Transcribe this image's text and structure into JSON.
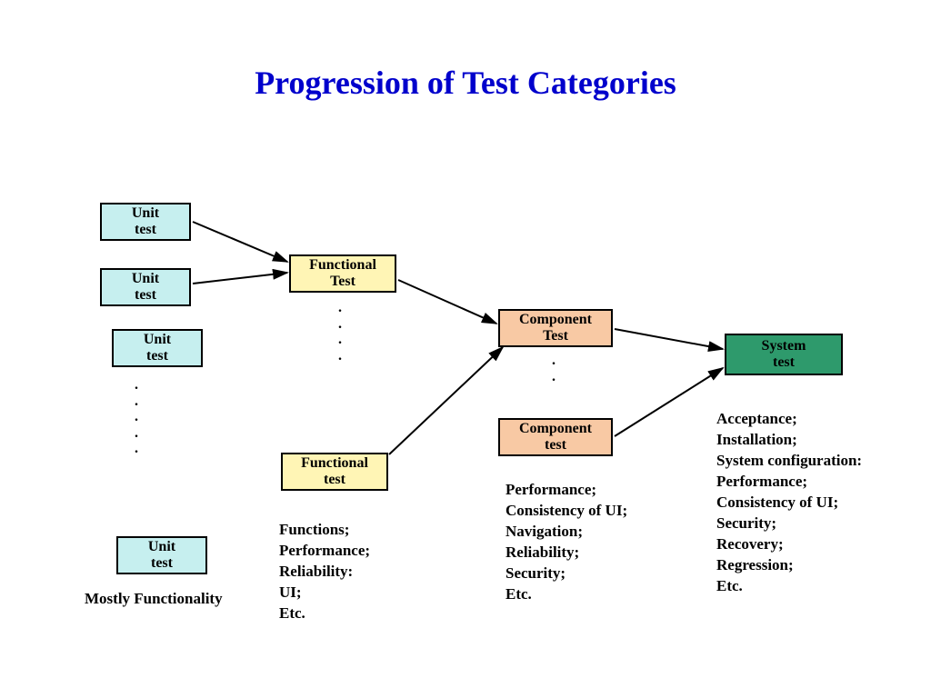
{
  "title": "Progression of Test Categories",
  "boxes": {
    "unit1": "Unit\ntest",
    "unit2": "Unit\ntest",
    "unit3": "Unit\ntest",
    "unit4": "Unit\ntest",
    "func1": "Functional\nTest",
    "func2": "Functional\ntest",
    "comp1": "Component\nTest",
    "comp2": "Component\ntest",
    "sys": "System\ntest"
  },
  "notes": {
    "unit": "Mostly Functionality",
    "func": "Functions;\nPerformance;\nReliability:\nUI;\nEtc.",
    "comp": "Performance;\nConsistency of UI;\nNavigation;\nReliability;\nSecurity;\n Etc.",
    "sys": "Acceptance;\nInstallation;\nSystem configuration:\nPerformance;\nConsistency of UI;\nSecurity;\nRecovery;\nRegression;\nEtc."
  },
  "ellipsis": {
    "unitDots": ".\n.\n.\n.\n.",
    "funcDots": ".\n.\n.\n.",
    "compDots": ".\n."
  }
}
